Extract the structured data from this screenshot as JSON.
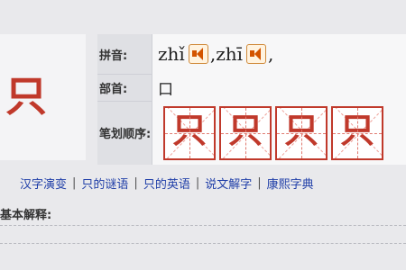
{
  "character": "只",
  "labels": {
    "pinyin": "拼音:",
    "radical": "部首:",
    "stroke_order": "笔划顺序:"
  },
  "pinyin": [
    "zhǐ",
    "zhī"
  ],
  "separator": ",",
  "radical": "口",
  "stroke_frames": [
    "只",
    "只",
    "只",
    "只"
  ],
  "links": [
    "汉字演变",
    "只的谜语",
    "只的英语",
    "说文解字",
    "康熙字典"
  ],
  "basic_heading": "基本解释:"
}
